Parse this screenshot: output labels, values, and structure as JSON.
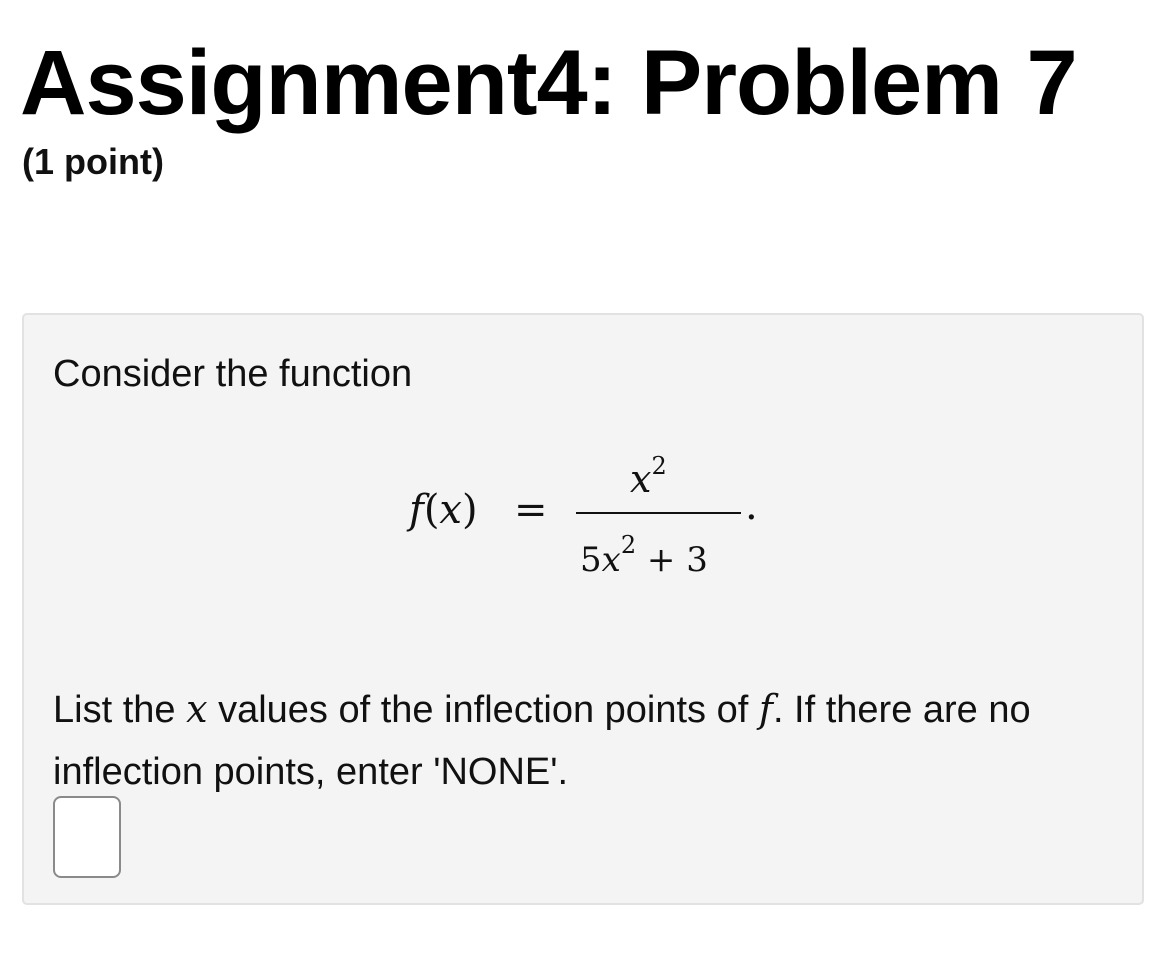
{
  "header": {
    "title": "Assignment4: Problem 7",
    "points": "(1 point)"
  },
  "problem": {
    "intro": "Consider the function",
    "equation": {
      "lhs_func": "f",
      "lhs_open": "(",
      "lhs_var": "x",
      "lhs_close": ")",
      "equals": "=",
      "numerator_var": "x",
      "numerator_exp": "2",
      "denominator_coef": "5",
      "denominator_var": "x",
      "denominator_exp": "2",
      "denominator_rest": " + 3",
      "period": "."
    },
    "question": {
      "part1": "List the ",
      "var_x": "x",
      "part2": " values of the inflection points of ",
      "var_f": "f",
      "part3": ". If there are no inflection points, enter 'NONE'."
    },
    "answer": {
      "value": ""
    }
  }
}
